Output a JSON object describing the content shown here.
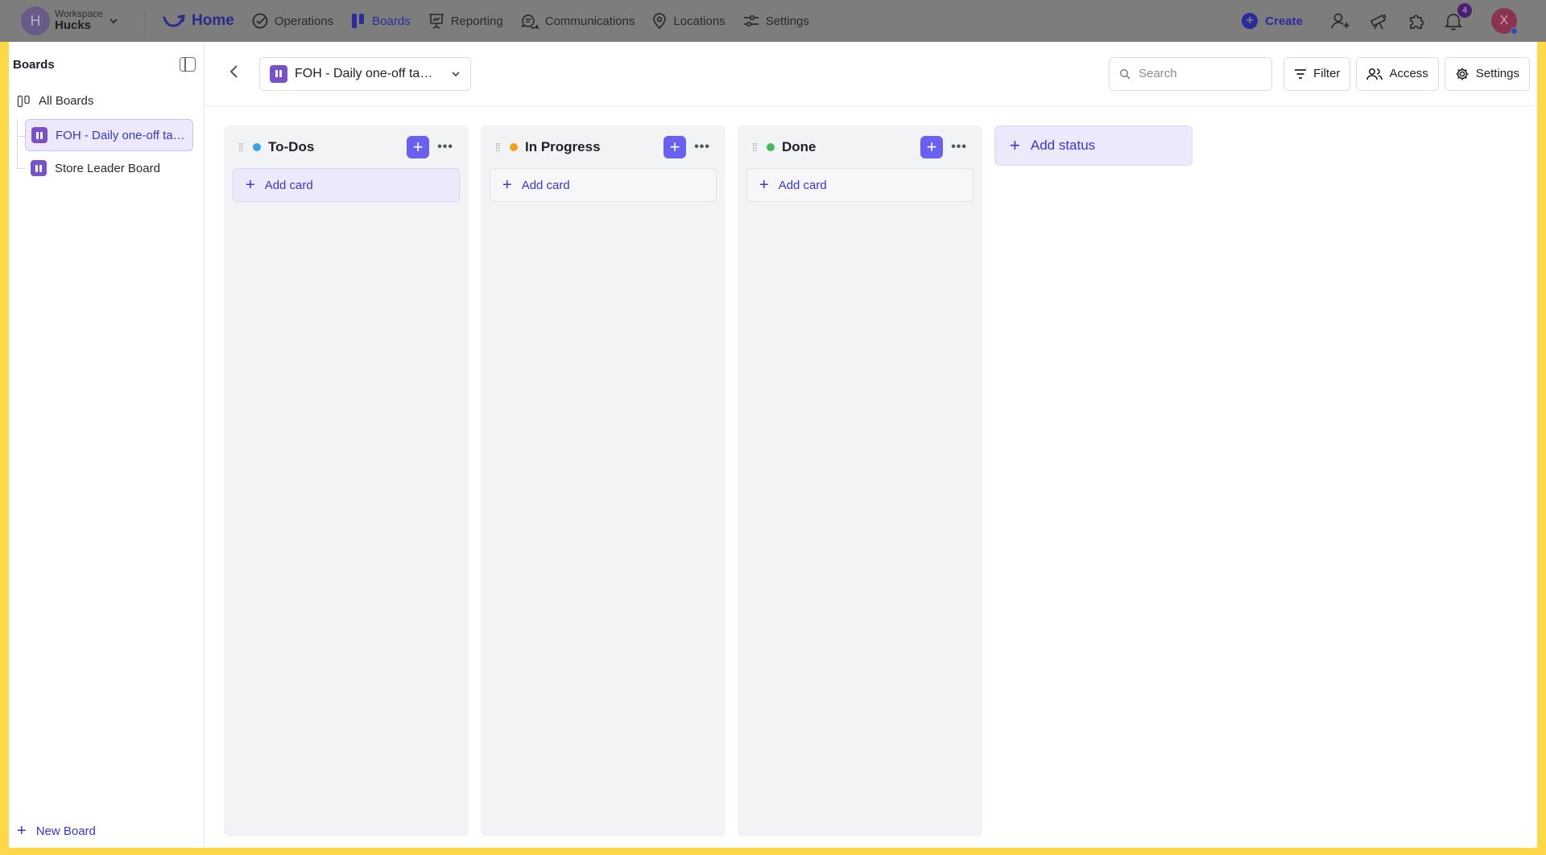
{
  "topbar": {
    "workspace_label": "Workspace",
    "workspace_name": "Hucks",
    "workspace_initial": "H",
    "nav": {
      "home": "Home",
      "operations": "Operations",
      "boards": "Boards",
      "reporting": "Reporting",
      "communications": "Communications",
      "locations": "Locations",
      "settings": "Settings"
    },
    "create_label": "Create",
    "notification_count": "4",
    "user_initial": "X"
  },
  "sidebar": {
    "title": "Boards",
    "all_boards": "All Boards",
    "boards": [
      {
        "label": "FOH - Daily one-off tasks",
        "active": true
      },
      {
        "label": "Store Leader Board",
        "active": false
      }
    ],
    "new_board": "New Board"
  },
  "toolbar": {
    "selected_board": "FOH - Daily one-off tasks",
    "search_placeholder": "Search",
    "filter_label": "Filter",
    "access_label": "Access",
    "settings_label": "Settings"
  },
  "columns": [
    {
      "title": "To-Dos",
      "dot_color": "#3aa3e8",
      "add_card_label": "Add card"
    },
    {
      "title": "In Progress",
      "dot_color": "#f0a020",
      "add_card_label": "Add card"
    },
    {
      "title": "Done",
      "dot_color": "#4cb85c",
      "add_card_label": "Add card"
    }
  ],
  "add_status_label": "Add status",
  "colors": {
    "accent": "#6a60f0",
    "board_icon": "#7a52c7",
    "frame": "#ffd84a"
  }
}
